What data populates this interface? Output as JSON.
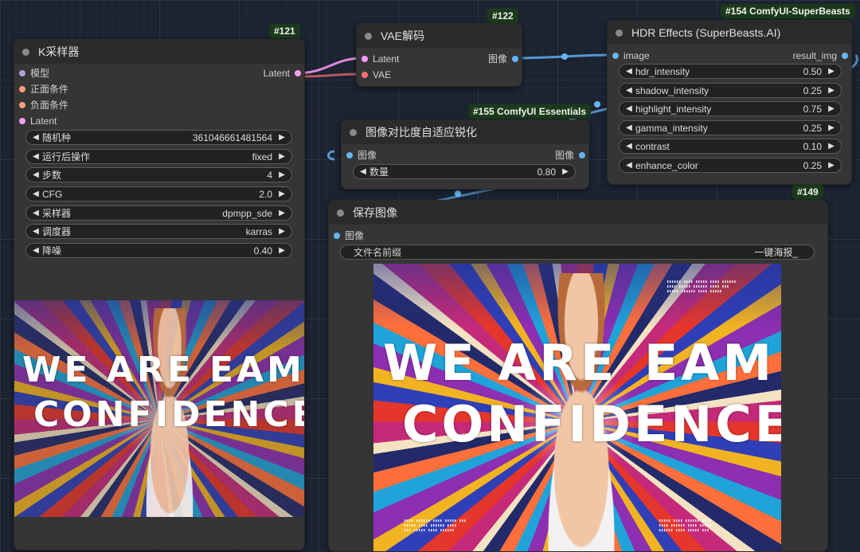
{
  "ksampler": {
    "id": "#121",
    "title": "K采样器",
    "inputs": [
      "模型",
      "正面条件",
      "负面条件",
      "Latent"
    ],
    "output": "Latent",
    "widgets": [
      {
        "label": "随机种",
        "value": "361046661481564"
      },
      {
        "label": "运行后操作",
        "value": "fixed"
      },
      {
        "label": "步数",
        "value": "4"
      },
      {
        "label": "CFG",
        "value": "2.0"
      },
      {
        "label": "采样器",
        "value": "dpmpp_sde"
      },
      {
        "label": "调度器",
        "value": "karras"
      },
      {
        "label": "降噪",
        "value": "0.40"
      }
    ],
    "preview": {
      "line1": "WE ARE",
      "line1b": "EAM",
      "line2": "CONFIDENCE"
    }
  },
  "vae_decode": {
    "id": "#122",
    "title": "VAE解码",
    "inputs": [
      "Latent",
      "VAE"
    ],
    "output": "图像"
  },
  "hdr": {
    "id": "#154 ComfyUI-SuperBeasts",
    "title": "HDR Effects (SuperBeasts.AI)",
    "input": "image",
    "output": "result_img",
    "widgets": [
      {
        "label": "hdr_intensity",
        "value": "0.50"
      },
      {
        "label": "shadow_intensity",
        "value": "0.25"
      },
      {
        "label": "highlight_intensity",
        "value": "0.75"
      },
      {
        "label": "gamma_intensity",
        "value": "0.25"
      },
      {
        "label": "contrast",
        "value": "0.10"
      },
      {
        "label": "enhance_color",
        "value": "0.25"
      }
    ]
  },
  "sharpen": {
    "id": "#155 ComfyUI Essentials",
    "title": "图像对比度自适应锐化",
    "input": "图像",
    "output": "图像",
    "widgets": [
      {
        "label": "数量",
        "value": "0.80"
      }
    ]
  },
  "save": {
    "id": "#149",
    "title": "保存图像",
    "input": "图像",
    "filename_label": "文件名前缀",
    "filename_value": "一键海报_",
    "preview": {
      "line1": "WE ARE",
      "line1b": "EAM",
      "line2": "CONFIDENCE"
    }
  },
  "colors": {
    "model_pin": "#b39ddb",
    "conditioning_pin": "#ffa07a",
    "latent_pin": "#ff9cf9",
    "vae_pin": "#ff6e6e",
    "image_pin": "#64b5f6",
    "latent_wire": "#ff9cf9",
    "image_wire": "#64b5f6"
  }
}
